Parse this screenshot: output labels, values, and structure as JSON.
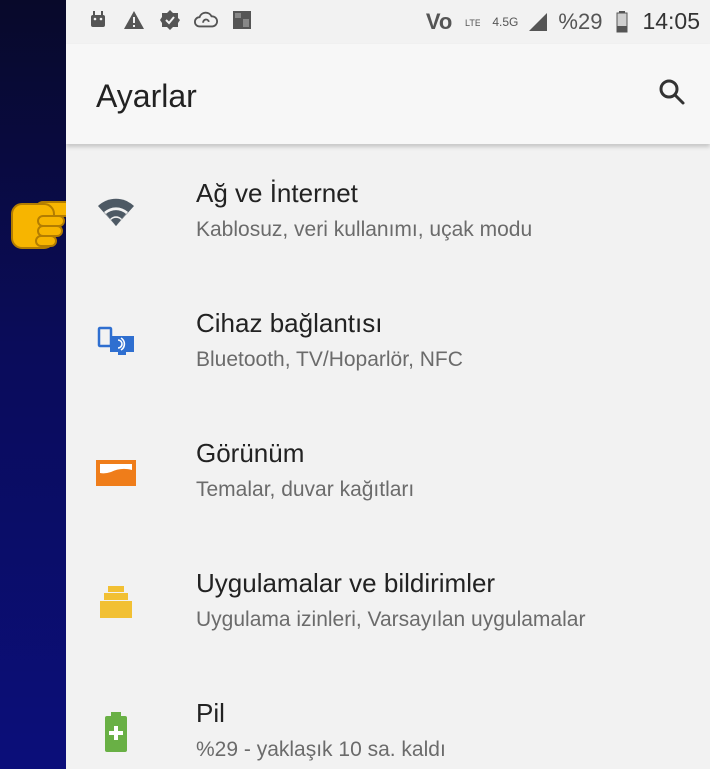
{
  "status_bar": {
    "carrier_indicator": "Vo",
    "network": "4.5G",
    "battery": "%29",
    "time": "14:05",
    "icons": [
      "android-debug-icon",
      "warning-icon",
      "verified-badge-icon",
      "cloud-sync-icon",
      "image-icon",
      "volte-icon",
      "lte-icon",
      "signal-icon",
      "battery-icon"
    ]
  },
  "appbar": {
    "title": "Ayarlar",
    "search_icon": "search-icon"
  },
  "settings": [
    {
      "title": "Ağ ve İnternet",
      "subtitle": "Kablosuz, veri kullanımı, uçak modu",
      "icon": "wifi-icon",
      "icon_color": "#4d5964"
    },
    {
      "title": "Cihaz bağlantısı",
      "subtitle": "Bluetooth, TV/Hoparlör, NFC",
      "icon": "device-connection-icon",
      "icon_color": "#2f6fd0"
    },
    {
      "title": "Görünüm",
      "subtitle": "Temalar, duvar kağıtları",
      "icon": "display-icon",
      "icon_color": "#ef7d1a"
    },
    {
      "title": "Uygulamalar ve bildirimler",
      "subtitle": "Uygulama izinleri, Varsayılan uygulamalar",
      "icon": "apps-icon",
      "icon_color": "#f2c033"
    },
    {
      "title": "Pil",
      "subtitle": "%29 - yaklaşık 10 sa. kaldı",
      "icon": "battery-icon",
      "icon_color": "#69b045"
    }
  ],
  "annotation": {
    "pointer_icon": "pointing-hand-icon",
    "pointer_color": "#f7b500"
  }
}
